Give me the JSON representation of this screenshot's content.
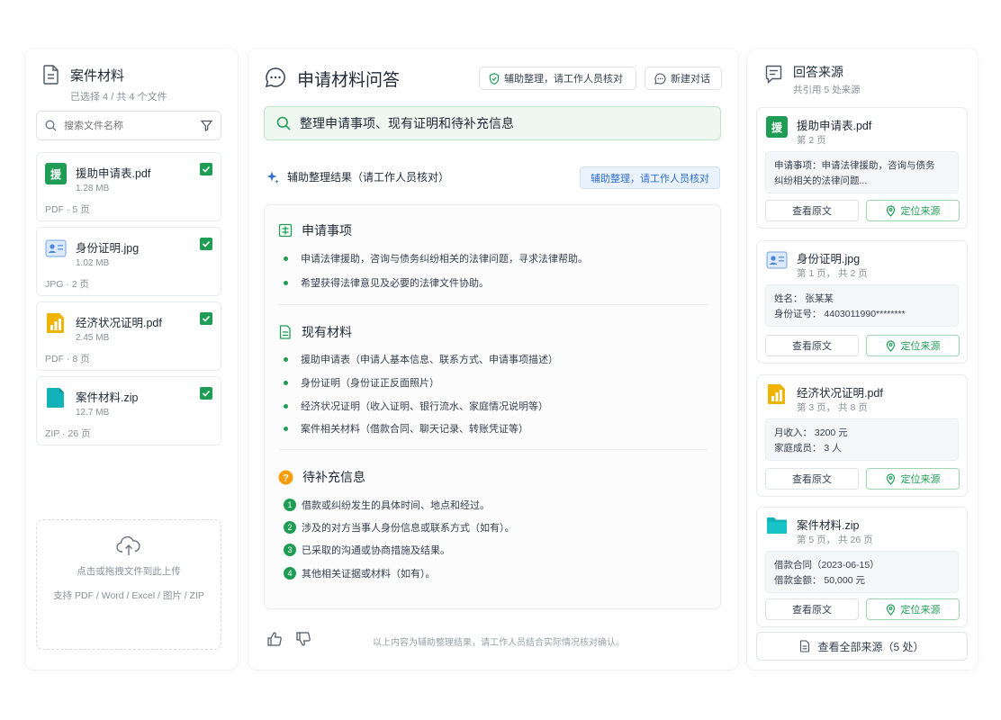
{
  "colors": {
    "accent": "#1f9d55",
    "query_bg": "#eef8f0",
    "badge_blue": "#2f6fd0",
    "warn": "#f59e0b"
  },
  "left": {
    "title": "案件材料",
    "subtitle": "已选择 4 / 共 4 个文件",
    "search_placeholder": "搜索文件名称",
    "files": [
      {
        "name": "援助申请表.pdf",
        "size": "1.28 MB",
        "meta": "PDF · 5 页",
        "icon": "pdf-green-icon",
        "glyph": "援",
        "checked": true
      },
      {
        "name": "身份证明.jpg",
        "size": "1.02 MB",
        "meta": "JPG · 2 页",
        "icon": "id-card-icon",
        "checked": true
      },
      {
        "name": "经济状况证明.pdf",
        "size": "2.45 MB",
        "meta": "PDF · 8 页",
        "icon": "bar-chart-file-icon",
        "checked": true
      },
      {
        "name": "案件材料.zip",
        "size": "12.7 MB",
        "meta": "ZIP · 26 页",
        "icon": "zip-file-icon",
        "checked": true
      }
    ],
    "upload": {
      "text": "点击或拖拽文件到此上传",
      "formats": "支持 PDF / Word / Excel / 图片 / ZIP"
    }
  },
  "center": {
    "title": "申请材料问答",
    "aux_button": "辅助整理，请工作人员核对",
    "new_chat_button": "新建对话",
    "query": "整理申请事项、现有证明和待补充信息",
    "result_title": "辅助整理结果（请工作人员核对）",
    "result_badge": "辅助整理，请工作人员核对",
    "sections": {
      "request": {
        "title": "申请事项",
        "items": [
          "申请法律援助，咨询与债务纠纷相关的法律问题，寻求法律帮助。",
          "希望获得法律意见及必要的法律文件协助。"
        ]
      },
      "materials": {
        "title": "现有材料",
        "items": [
          "援助申请表（申请人基本信息、联系方式、申请事项描述）",
          "身份证明（身份证正反面照片）",
          "经济状况证明（收入证明、银行流水、家庭情况说明等）",
          "案件相关材料（借款合同、聊天记录、转账凭证等）"
        ]
      },
      "pending": {
        "title": "待补充信息",
        "items": [
          {
            "n": "1",
            "text": "借款或纠纷发生的具体时间、地点和经过。"
          },
          {
            "n": "2",
            "text": "涉及的对方当事人身份信息或联系方式（如有）。"
          },
          {
            "n": "3",
            "text": "已采取的沟通或协商措施及结果。"
          },
          {
            "n": "4",
            "text": "其他相关证据或材料（如有）。"
          }
        ]
      }
    },
    "footer": "以上内容为辅助整理结果，请工作人员结合实际情况核对确认。"
  },
  "right": {
    "title": "回答来源",
    "subtitle": "共引用 5 处来源",
    "view_label": "查看原文",
    "locate_label": "定位来源",
    "sources": [
      {
        "name": "援助申请表.pdf",
        "page": "第 2 页",
        "lines": [
          "申请事项：申请法律援助，咨询与债务",
          "纠纷相关的法律问题..."
        ]
      },
      {
        "name": "身份证明.jpg",
        "page": "第 1 页， 共 2 页",
        "lines": [
          "姓名：  张某某",
          "身份证号：  4403011990********"
        ]
      },
      {
        "name": "经济状况证明.pdf",
        "page": "第 3 页， 共 8 页",
        "lines": [
          "月收入：  3200  元",
          "家庭成员：  3  人"
        ]
      },
      {
        "name": "案件材料.zip",
        "page": "第 5 页， 共 26 页",
        "lines": [
          "借款合同（2023-06-15）",
          "借款金额：  50,000  元"
        ]
      }
    ],
    "all_sources": "查看全部来源（5 处）"
  }
}
